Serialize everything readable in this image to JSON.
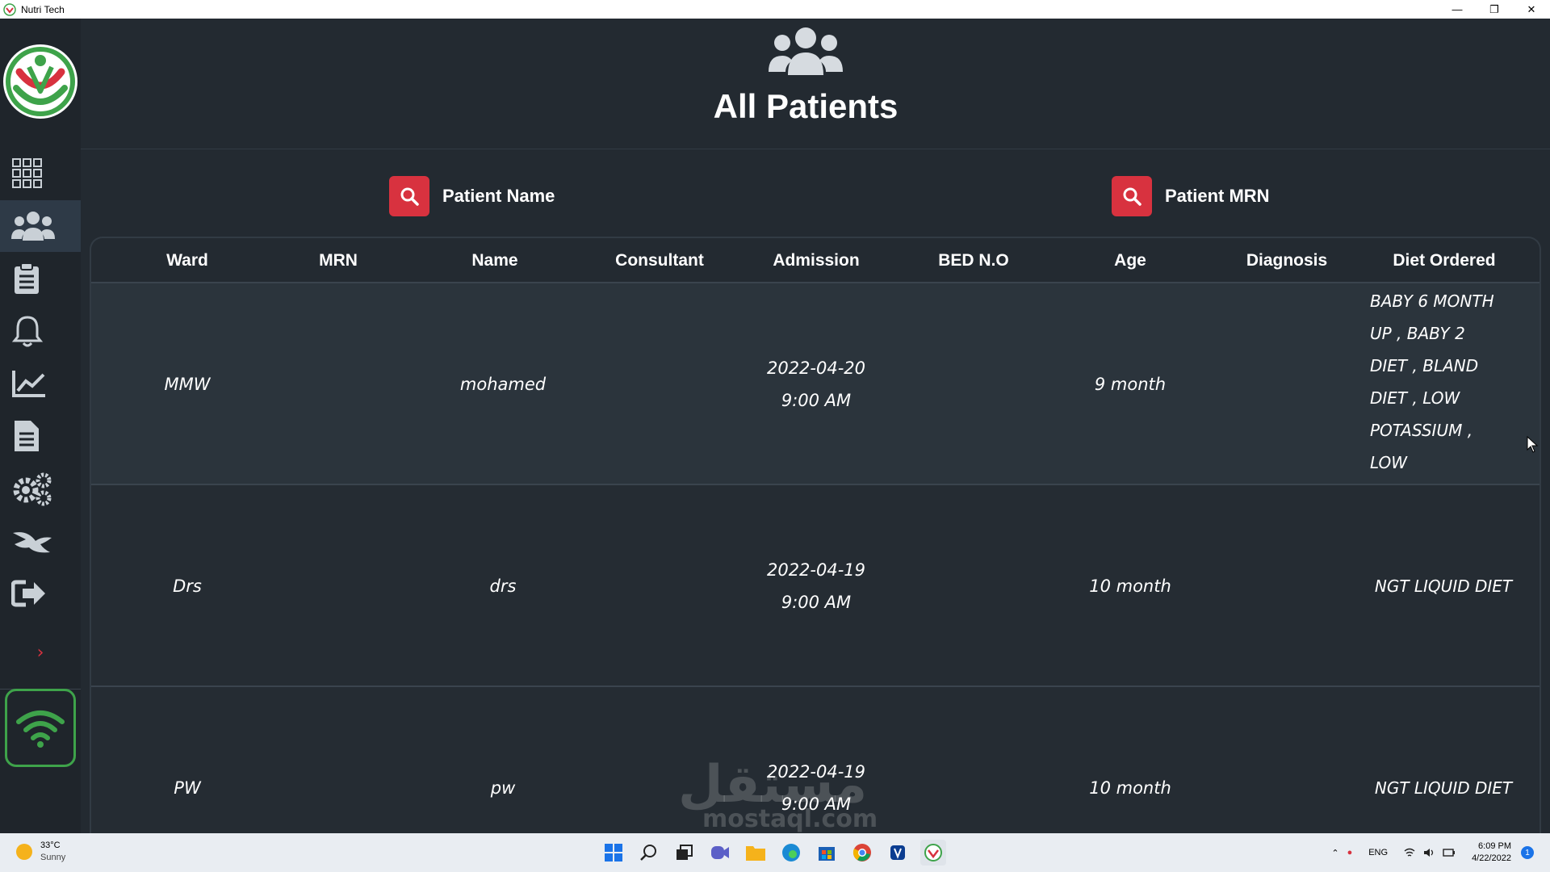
{
  "window": {
    "title": "Nutri Tech",
    "controls": {
      "minimize": "—",
      "restore": "❐",
      "close": "✕"
    }
  },
  "sidebar": {
    "items": [
      {
        "name": "dashboard",
        "icon": "grid-icon",
        "active": false
      },
      {
        "name": "patients",
        "icon": "users-icon",
        "active": true
      },
      {
        "name": "orders",
        "icon": "clipboard-icon",
        "active": false
      },
      {
        "name": "notifications",
        "icon": "bell-icon",
        "active": false
      },
      {
        "name": "reports",
        "icon": "chart-line-icon",
        "active": false
      },
      {
        "name": "documents",
        "icon": "document-icon",
        "active": false
      },
      {
        "name": "settings",
        "icon": "gears-icon",
        "active": false
      },
      {
        "name": "about",
        "icon": "bird-icon",
        "active": false
      },
      {
        "name": "logout",
        "icon": "logout-icon",
        "active": false
      }
    ],
    "expand_glyph": "›",
    "accent": "#d8323f",
    "connection_color": "#3ea34a"
  },
  "header": {
    "title": "All Patients"
  },
  "search": {
    "name_label": "Patient Name",
    "mrn_label": "Patient MRN"
  },
  "table": {
    "columns": [
      "Ward",
      "MRN",
      "Name",
      "Consultant",
      "Admission",
      "BED N.O",
      "Age",
      "Diagnosis",
      "Diet Ordered"
    ],
    "rows": [
      {
        "ward": "MMW",
        "mrn": "",
        "name": "mohamed",
        "consultant": "",
        "admission_date": "2022-04-20",
        "admission_time": "9:00 AM",
        "bed": "",
        "age": "9 month",
        "diagnosis": "",
        "diet": [
          "BABY 6 MONTH",
          "UP , BABY 2",
          "DIET , BLAND",
          "DIET , LOW",
          "POTASSIUM ,",
          "LOW"
        ]
      },
      {
        "ward": "Drs",
        "mrn": "",
        "name": "drs",
        "consultant": "",
        "admission_date": "2022-04-19",
        "admission_time": "9:00 AM",
        "bed": "",
        "age": "10 month",
        "diagnosis": "",
        "diet": [
          "NGT LIQUID DIET"
        ]
      },
      {
        "ward": "PW",
        "mrn": "",
        "name": "pw",
        "consultant": "",
        "admission_date": "2022-04-19",
        "admission_time": "9:00 AM",
        "bed": "",
        "age": "10 month",
        "diagnosis": "",
        "diet": [
          "NGT LIQUID DIET"
        ]
      }
    ]
  },
  "watermark": {
    "text": "مستقل",
    "subtext": "mostaql.com"
  },
  "taskbar": {
    "weather_temp": "33°C",
    "weather_desc": "Sunny",
    "lang": "ENG",
    "time": "6:09 PM",
    "date": "4/22/2022",
    "notifications": "1"
  }
}
